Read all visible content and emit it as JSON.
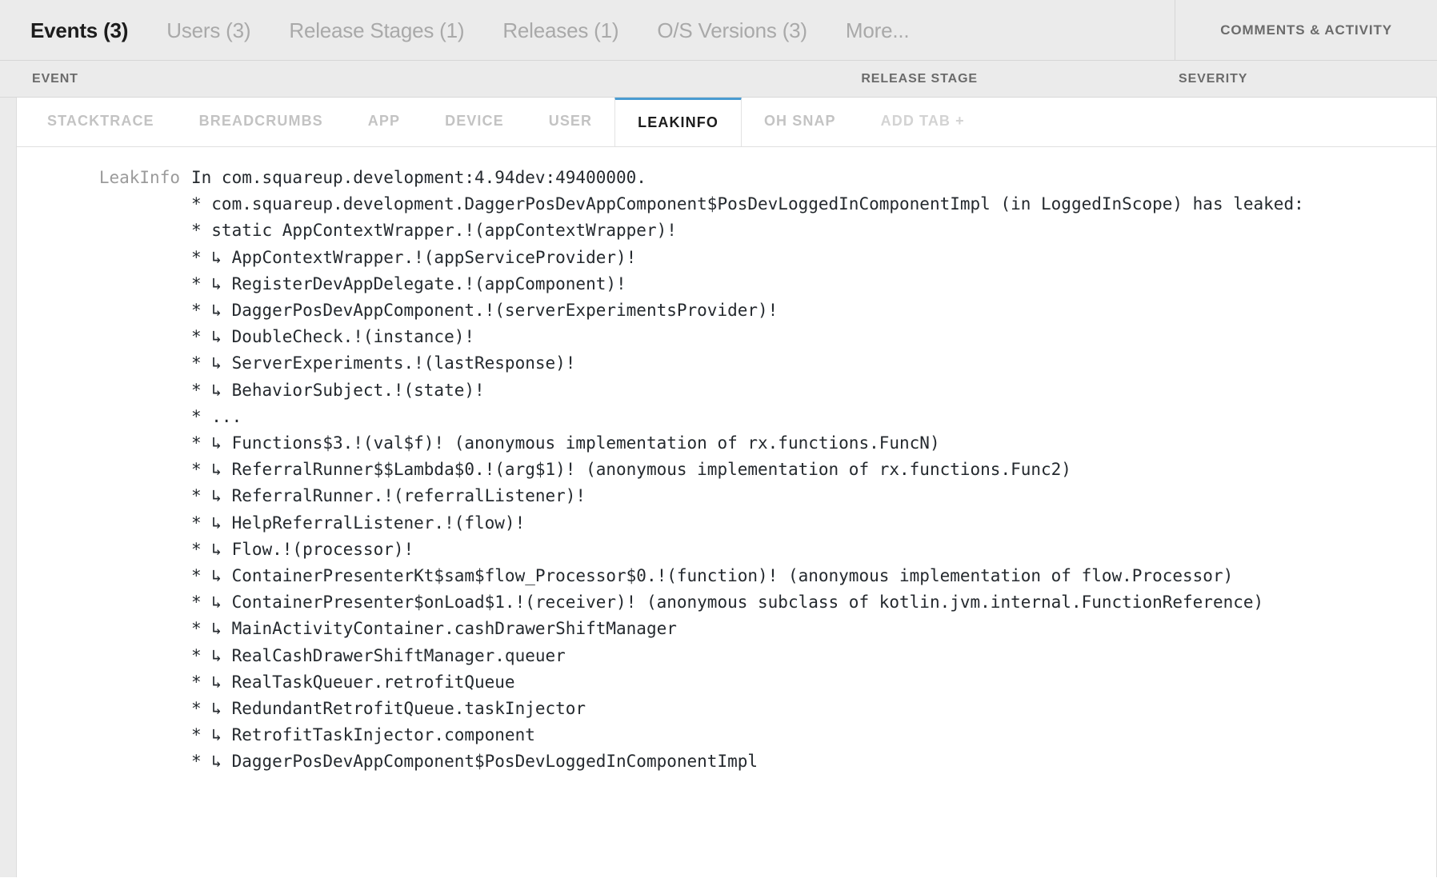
{
  "top_nav": {
    "tabs": [
      {
        "label": "Events (3)",
        "active": true
      },
      {
        "label": "Users (3)",
        "active": false
      },
      {
        "label": "Release Stages (1)",
        "active": false
      },
      {
        "label": "Releases (1)",
        "active": false
      },
      {
        "label": "O/S Versions (3)",
        "active": false
      },
      {
        "label": "More...",
        "active": false
      }
    ],
    "comments_activity": "COMMENTS & ACTIVITY"
  },
  "column_header": {
    "event": "EVENT",
    "release_stage": "RELEASE STAGE",
    "severity": "SEVERITY"
  },
  "detail_tabs": [
    {
      "label": "STACKTRACE",
      "active": false
    },
    {
      "label": "BREADCRUMBS",
      "active": false
    },
    {
      "label": "APP",
      "active": false
    },
    {
      "label": "DEVICE",
      "active": false
    },
    {
      "label": "USER",
      "active": false
    },
    {
      "label": "LEAKINFO",
      "active": true
    },
    {
      "label": "OH SNAP",
      "active": false
    },
    {
      "label": "ADD TAB +",
      "active": false
    }
  ],
  "leak_info": {
    "label": "LeakInfo",
    "lines": [
      "In com.squareup.development:4.94dev:49400000.",
      "* com.squareup.development.DaggerPosDevAppComponent$PosDevLoggedInComponentImpl (in LoggedInScope) has leaked:",
      "* static AppContextWrapper.!(appContextWrapper)!",
      "* ↳ AppContextWrapper.!(appServiceProvider)!",
      "* ↳ RegisterDevAppDelegate.!(appComponent)!",
      "* ↳ DaggerPosDevAppComponent.!(serverExperimentsProvider)!",
      "* ↳ DoubleCheck.!(instance)!",
      "* ↳ ServerExperiments.!(lastResponse)!",
      "* ↳ BehaviorSubject.!(state)!",
      "* ...",
      "* ↳ Functions$3.!(val$f)! (anonymous implementation of rx.functions.FuncN)",
      "* ↳ ReferralRunner$$Lambda$0.!(arg$1)! (anonymous implementation of rx.functions.Func2)",
      "* ↳ ReferralRunner.!(referralListener)!",
      "* ↳ HelpReferralListener.!(flow)!",
      "* ↳ Flow.!(processor)!",
      "* ↳ ContainerPresenterKt$sam$flow_Processor$0.!(function)! (anonymous implementation of flow.Processor)",
      "* ↳ ContainerPresenter$onLoad$1.!(receiver)! (anonymous subclass of kotlin.jvm.internal.FunctionReference)",
      "* ↳ MainActivityContainer.cashDrawerShiftManager",
      "* ↳ RealCashDrawerShiftManager.queuer",
      "* ↳ RealTaskQueuer.retrofitQueue",
      "* ↳ RedundantRetrofitQueue.taskInjector",
      "* ↳ RetrofitTaskInjector.component",
      "* ↳ DaggerPosDevAppComponent$PosDevLoggedInComponentImpl"
    ]
  },
  "colors": {
    "active_tab_underline": "#4a9bd1",
    "chrome_background": "#ebebeb",
    "panel_background": "#ffffff",
    "text_primary": "#1c1c1c",
    "text_muted": "#a9a9a9",
    "code_text": "#24292e"
  }
}
